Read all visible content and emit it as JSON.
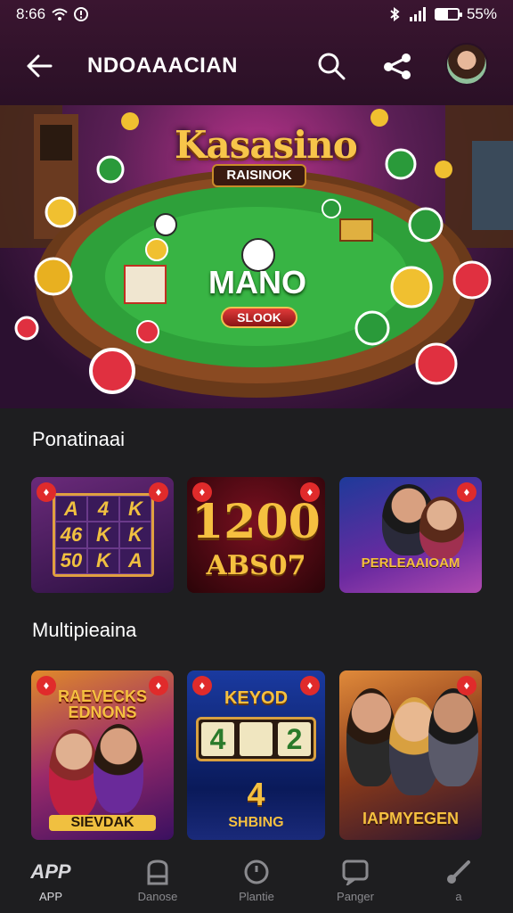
{
  "status_bar": {
    "time": "8:66",
    "battery_percent": "55%",
    "battery_level": 0.55
  },
  "app_bar": {
    "title": "NDOAAACIAN"
  },
  "hero": {
    "title": "Kasasino",
    "subtitle": "RAISINOK",
    "center_text": "MANO",
    "button_label": "SLOOK"
  },
  "sections": [
    {
      "title": "Ponatinaai"
    },
    {
      "title": "Multipieaina"
    }
  ],
  "cards": {
    "c1": {
      "symbols": [
        "A",
        "4",
        "K",
        "46",
        "K",
        "K",
        "50",
        "K",
        "A"
      ]
    },
    "c2": {
      "big": "1200",
      "sub": "ABS07"
    },
    "c3": {
      "label": "PERLEAAIOAM"
    },
    "c4": {
      "top": "RAEVECKS EDNONS",
      "bottom": "SIEVDAK"
    },
    "c5": {
      "top": "KEYOD",
      "reels": [
        "4",
        "",
        "2"
      ],
      "num": "4",
      "bottom": "SHBING"
    },
    "c6": {
      "bottom": "IAPMYEGEN"
    }
  },
  "nav": [
    {
      "icon": "app-icon",
      "label": "APP",
      "active": true
    },
    {
      "icon": "house-icon",
      "label": "Danose"
    },
    {
      "icon": "clock-icon",
      "label": "Plantie"
    },
    {
      "icon": "chat-icon",
      "label": "Panger"
    },
    {
      "icon": "brush-icon",
      "label": "a"
    }
  ],
  "colors": {
    "accent": "#e02b2b",
    "background": "#1e1e20",
    "gold": "#f5c040"
  }
}
